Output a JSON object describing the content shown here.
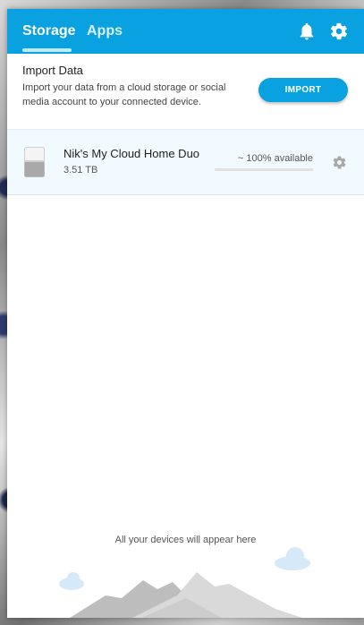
{
  "header": {
    "tabs": [
      {
        "label": "Storage",
        "active": true
      },
      {
        "label": "Apps",
        "active": false
      }
    ],
    "icons": [
      "bell-icon",
      "gear-icon"
    ],
    "accent_color": "#0aa1e1"
  },
  "import": {
    "title": "Import Data",
    "description": "Import your data from a cloud storage or social media account to your connected device.",
    "button_label": "IMPORT"
  },
  "device": {
    "name": "Nik's My Cloud Home Duo",
    "capacity": "3.51 TB",
    "availability": "~ 100% available",
    "available_fraction": 1.0
  },
  "empty_state": {
    "text": "All your devices will appear here"
  }
}
